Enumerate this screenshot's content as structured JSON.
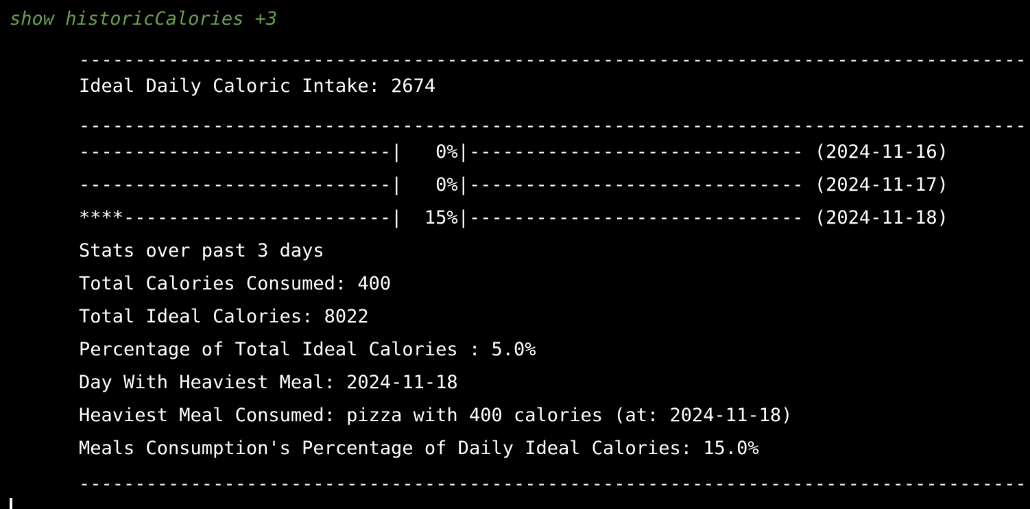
{
  "command": "show historicCalories +3",
  "colors": {
    "background": "#000000",
    "text": "#ffffff",
    "command": "#6a9f4f"
  },
  "output": {
    "separator_top": "-------------------------------------------------------------------------------------",
    "ideal_daily_intake": "Ideal Daily Caloric Intake: 2674",
    "separator_mid": "-------------------------------------------------------------------------------------",
    "bar_rows": [
      "----------------------------|   0%|------------------------------ (2024-11-16)",
      "----------------------------|   0%|------------------------------ (2024-11-17)",
      "****------------------------|  15%|------------------------------ (2024-11-18)"
    ],
    "stats_title": "Stats over past 3 days",
    "total_consumed": "Total Calories Consumed: 400",
    "total_ideal": "Total Ideal Calories: 8022",
    "percentage_total": "Percentage of Total Ideal Calories : 5.0%",
    "heaviest_day": "Day With Heaviest Meal: 2024-11-18",
    "heaviest_meal": "Heaviest Meal Consumed: pizza with 400 calories (at: 2024-11-18)",
    "meals_percentage": "Meals Consumption's Percentage of Daily Ideal Calories: 15.0%",
    "separator_bottom": "-------------------------------------------------------------------------------------"
  },
  "bar_values_percent": [
    0,
    0,
    15
  ],
  "bar_dates": [
    "2024-11-16",
    "2024-11-17",
    "2024-11-18"
  ]
}
